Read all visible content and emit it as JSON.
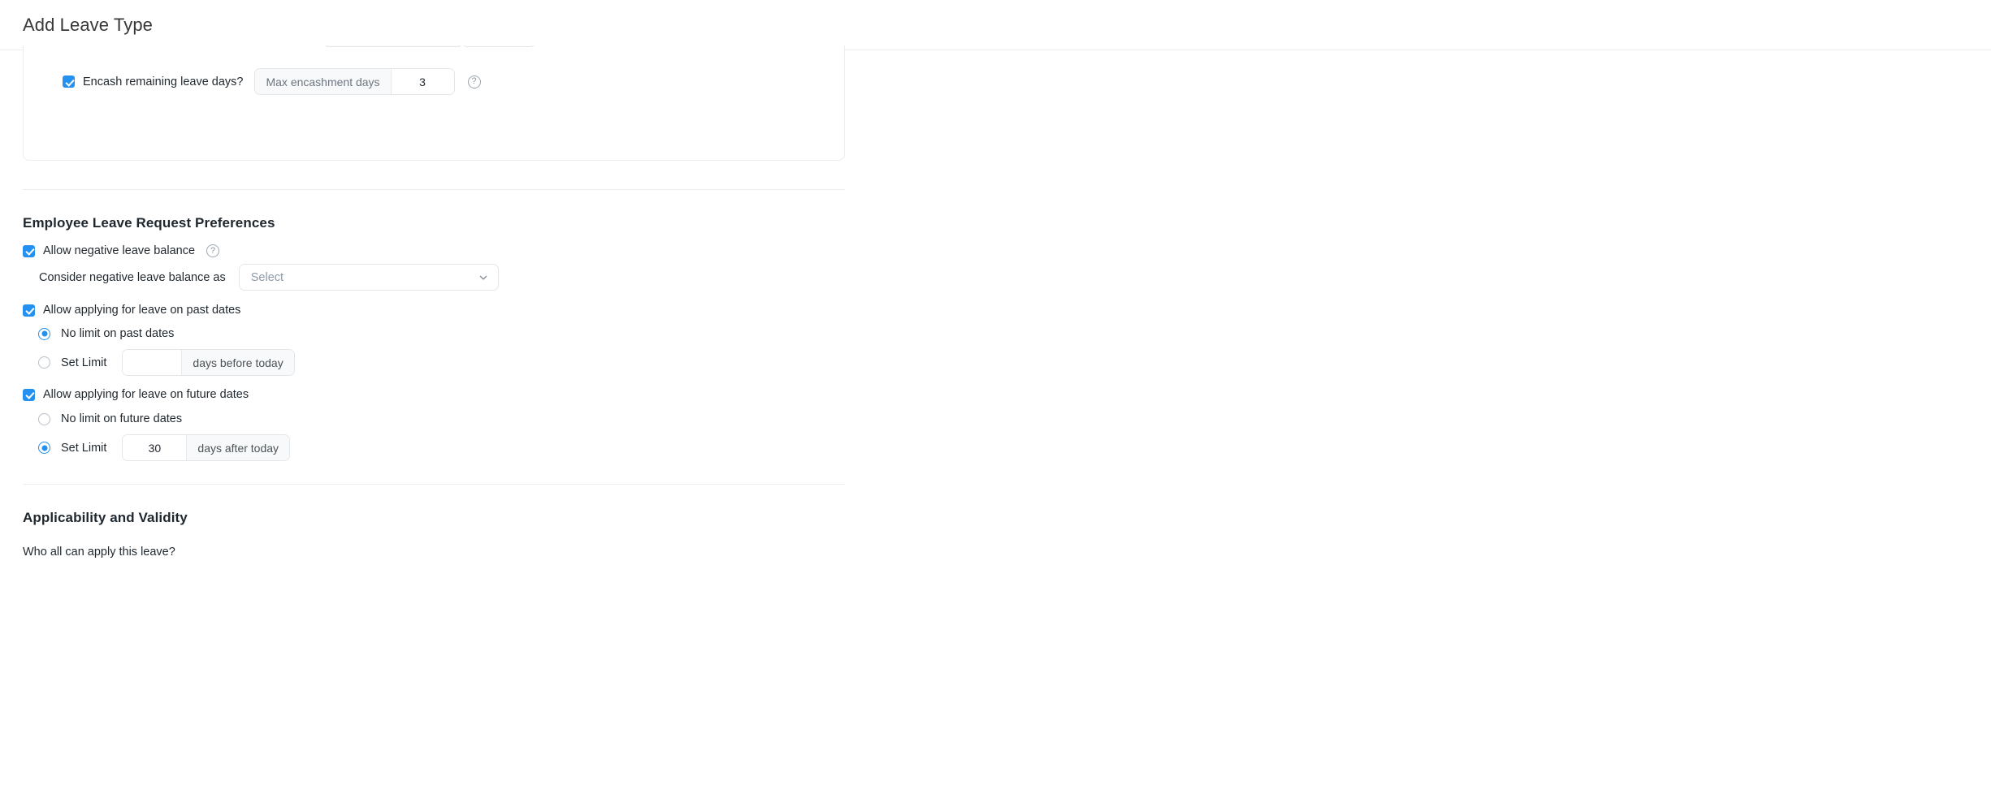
{
  "header": {
    "title": "Add Leave Type"
  },
  "encashment_card": {
    "encash_checkbox_label": "Encash remaining leave days?",
    "encash_checked": true,
    "max_encashment_prefix": "Max encashment days",
    "max_encashment_value": "3",
    "help_icon": "help-circle-icon"
  },
  "preferences": {
    "section_title": "Employee Leave Request Preferences",
    "allow_negative": {
      "label": "Allow negative leave balance",
      "checked": true,
      "help_icon": "help-circle-icon"
    },
    "consider_negative": {
      "label": "Consider negative leave balance as",
      "select_value": "Select",
      "chevron_icon": "chevron-down-icon"
    },
    "past_dates": {
      "label": "Allow applying for leave on past dates",
      "checked": true,
      "option_no_limit": "No limit on past dates",
      "option_no_limit_selected": true,
      "option_set_limit": "Set Limit",
      "option_set_limit_selected": false,
      "limit_value": "",
      "limit_suffix": "days before today"
    },
    "future_dates": {
      "label": "Allow applying for leave on future dates",
      "checked": true,
      "option_no_limit": "No limit on future dates",
      "option_no_limit_selected": false,
      "option_set_limit": "Set Limit",
      "option_set_limit_selected": true,
      "limit_value": "30",
      "limit_suffix": "days after today"
    }
  },
  "applicability": {
    "section_title": "Applicability and Validity",
    "who_can_apply_label": "Who all can apply this leave?"
  },
  "colors": {
    "accent": "#2490ef",
    "text": "#1f272e",
    "muted": "#8d99a6",
    "border": "#ebeef0",
    "field_bg": "#f8f9fa"
  }
}
